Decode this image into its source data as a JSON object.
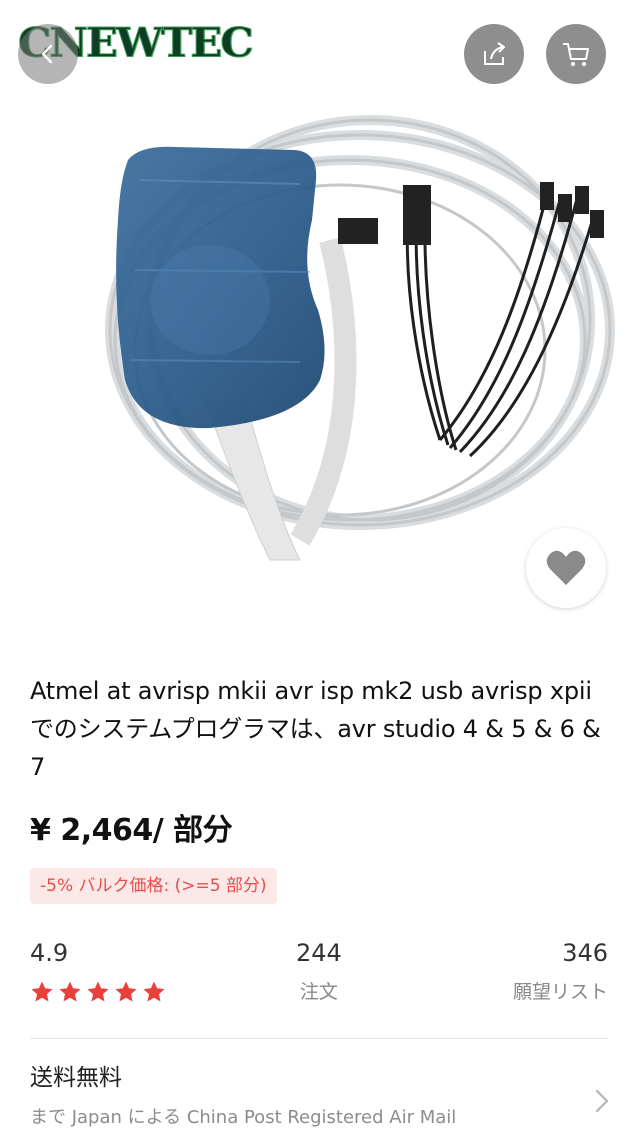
{
  "brand": {
    "name": "CNEWTEC"
  },
  "header": {
    "back_icon": "chevron-left-icon",
    "share_icon": "share-icon",
    "cart_icon": "cart-icon",
    "wishlist_icon": "heart-icon"
  },
  "product": {
    "title": "Atmel at avrisp mkii avr isp mk2 usb avrisp xpiiでのシステムプログラマは、avr studio 4 & 5 & 6 & 7",
    "price": "¥ 2,464/ 部分",
    "bulk_price": "-5% バルク価格: (>=5 部分)"
  },
  "stats": {
    "rating": "4.9",
    "stars": 5,
    "orders_count": "244",
    "orders_label": "注文",
    "wishlist_count": "346",
    "wishlist_label": "願望リスト"
  },
  "shipping": {
    "title": "送料無料",
    "detail": "まで Japan による China Post Registered Air Mail"
  },
  "colors": {
    "accent": "#e8403a",
    "badge_bg": "#fde8e8",
    "badge_text": "#e84d4d",
    "muted": "#888888"
  }
}
